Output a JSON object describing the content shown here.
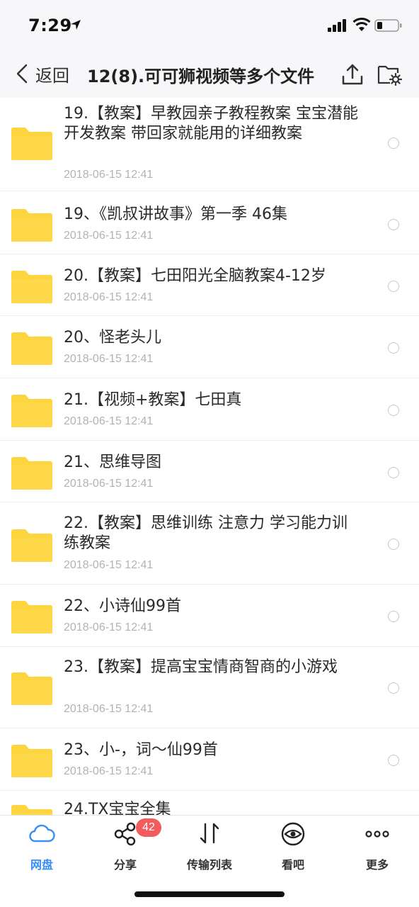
{
  "status_bar": {
    "time": "7:29"
  },
  "nav": {
    "back_label": "返回",
    "title": "12(8).可可狮视频等多个文件"
  },
  "colors": {
    "folder": "#fdd53e",
    "accent": "#3a8ef5",
    "badge": "#f25c5c"
  },
  "files": [
    {
      "name": "19.【教案】早教园亲子教程教案 宝宝潜能开发教案 带回家就能用的详细教案",
      "date": "2018-06-15 12:41"
    },
    {
      "name": "19、《凯叔讲故事》第一季 46集",
      "date": "2018-06-15 12:41"
    },
    {
      "name": "20.【教案】七田阳光全脑教案4-12岁",
      "date": "2018-06-15 12:41"
    },
    {
      "name": "20、怪老头儿",
      "date": "2018-06-15 12:41"
    },
    {
      "name": "21.【视频+教案】七田真",
      "date": "2018-06-15 12:41"
    },
    {
      "name": "21、思维导图",
      "date": "2018-06-15 12:41"
    },
    {
      "name": "22.【教案】思维训练 注意力 学习能力训练教案",
      "date": "2018-06-15 12:41"
    },
    {
      "name": "22、小诗仙99首",
      "date": "2018-06-15 12:41"
    },
    {
      "name": "23.【教案】提高宝宝情商智商的小游戏",
      "date": "2018-06-15 12:41"
    },
    {
      "name": "23、小-，词～仙99首",
      "date": "2018-06-15 12:41"
    },
    {
      "name": "24.TX宝宝全集",
      "date": ""
    }
  ],
  "tabs": [
    {
      "label": "网盘",
      "icon": "cloud-icon",
      "active": true
    },
    {
      "label": "分享",
      "icon": "share-icon",
      "badge": "42"
    },
    {
      "label": "传输列表",
      "icon": "transfer-icon"
    },
    {
      "label": "看吧",
      "icon": "eye-icon"
    },
    {
      "label": "更多",
      "icon": "more-icon"
    }
  ]
}
